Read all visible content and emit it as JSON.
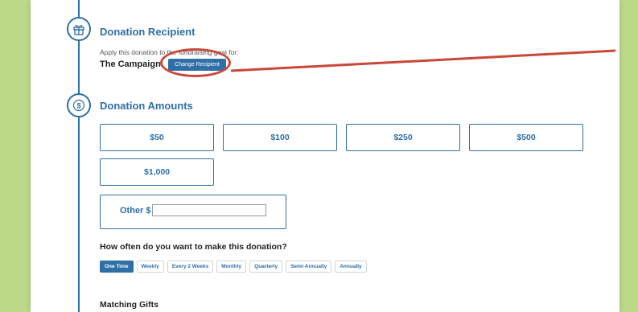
{
  "recipient": {
    "title": "Donation Recipient",
    "intro": "Apply this donation to the fundraising goal for:",
    "campaign": "The Campaign",
    "change_button": "Change Recipient"
  },
  "amounts": {
    "title": "Donation Amounts",
    "options": [
      "$50",
      "$100",
      "$250",
      "$500",
      "$1,000"
    ],
    "other_label": "Other $",
    "other_value": ""
  },
  "frequency": {
    "question": "How often do you want to make this donation?",
    "options": [
      "One Time",
      "Weekly",
      "Every 2 Weeks",
      "Monthly",
      "Quarterly",
      "Semi-Annually",
      "Annually"
    ],
    "selected": "One Time"
  },
  "matching": {
    "title": "Matching Gifts"
  },
  "icons": {
    "step1": "gift-icon",
    "step2": "dollar-icon"
  },
  "colors": {
    "accent": "#2f6fa6",
    "annotation": "#c9483a",
    "background": "#bcd98a"
  }
}
